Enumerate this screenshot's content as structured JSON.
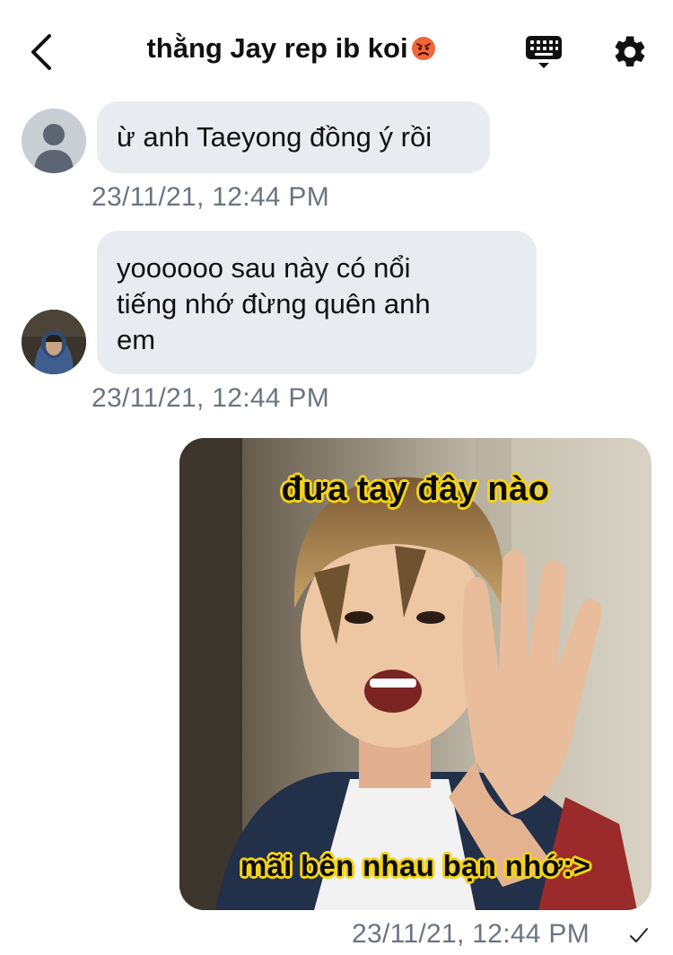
{
  "header": {
    "title": "thằng Jay rep ib koi",
    "title_emoji": "angry-face-emoji",
    "back_icon": "chevron-left-icon",
    "keyboard_icon": "keyboard-icon",
    "settings_icon": "gear-icon"
  },
  "messages": [
    {
      "sender": "other",
      "avatar": "default-avatar",
      "text": "ừ anh Taeyong đồng ý rồi",
      "timestamp": "23/11/21, 12:44 PM"
    },
    {
      "sender": "other",
      "avatar": "photo-avatar",
      "lines": [
        "yoooooo sau này có nổi",
        "tiếng nhớ đừng quên anh",
        "em"
      ],
      "timestamp": "23/11/21, 12:44 PM"
    },
    {
      "sender": "me",
      "type": "image",
      "image_caption_top": "đưa tay đây nào",
      "image_caption_bottom": "mãi bên nhau bạn nhớ:>",
      "timestamp": "23/11/21, 12:44 PM",
      "status_icon": "checkmark-icon"
    }
  ],
  "colors": {
    "bubble_bg": "#e8ebf0",
    "timestamp": "#6b7482",
    "meme_outline": "#f3d318"
  }
}
